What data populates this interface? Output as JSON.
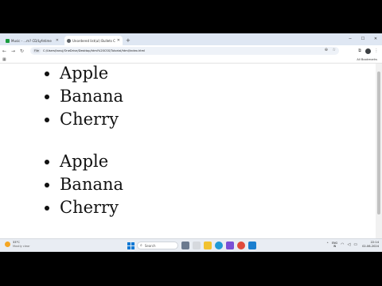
{
  "browser": {
    "tabs": [
      {
        "label": "Music - ...m? CD/Lyfetime",
        "favicon_color": "#1a9c3e",
        "active": false
      },
      {
        "label": "Unordered list(ul) Bullets Co...",
        "favicon_color": "#5f6368",
        "active": true
      }
    ],
    "new_tab_label": "+",
    "file_chip": "File",
    "url": "C:/Users/tanuj/OneDrive/Desktop/html%20CSS/Tutorial/html/index.html",
    "all_bookmarks": "All Bookmarks"
  },
  "page": {
    "list1": [
      "Apple",
      "Banana",
      "Cherry"
    ],
    "list2": [
      "Apple",
      "Banana",
      "Cherry"
    ]
  },
  "taskbar": {
    "weather_temp": "33°C",
    "weather_desc": "Mostly clear",
    "search_placeholder": "Search",
    "lang_top": "ENG",
    "lang_bottom": "IN",
    "time": "22:14",
    "date": "02-06-2024"
  },
  "colors": {
    "tabstrip": "#dfe7f3",
    "taskbar": "#e9edf3",
    "accent": "#0a78d4"
  }
}
